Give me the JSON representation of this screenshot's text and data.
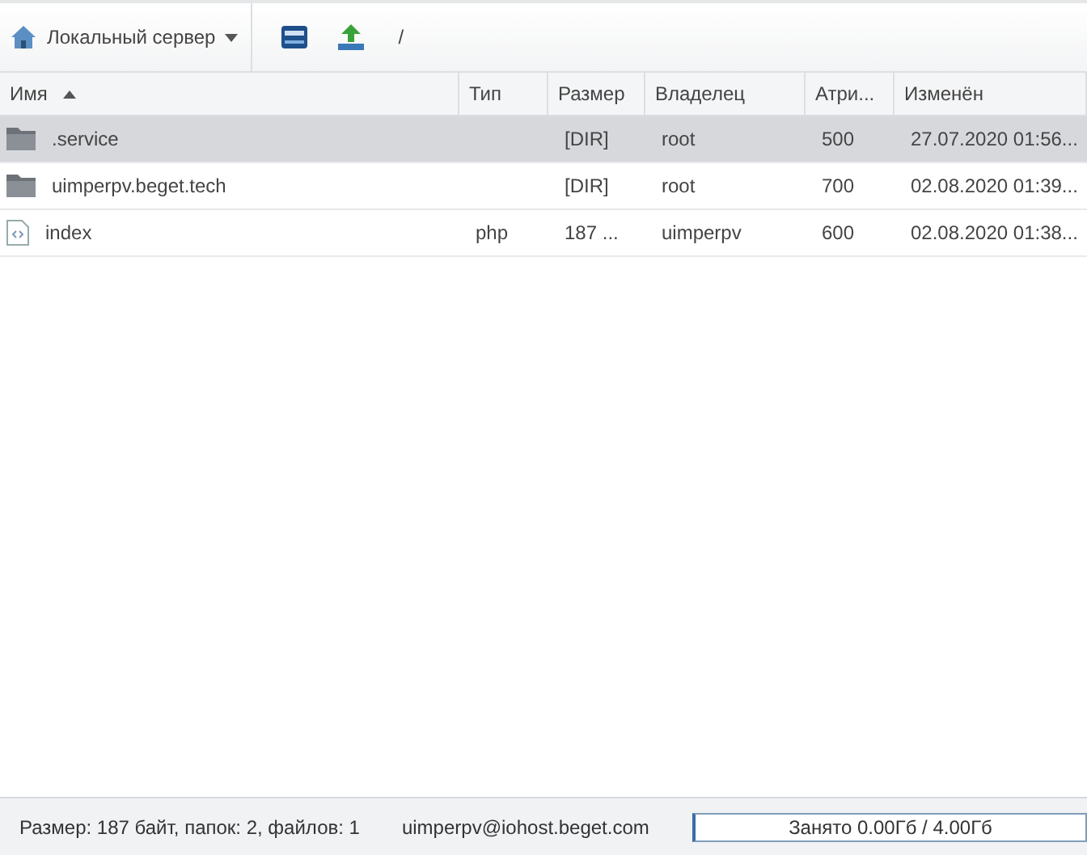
{
  "toolbar": {
    "server": "Локальный сервер",
    "path": "/"
  },
  "table": {
    "columns": [
      {
        "label": "Имя",
        "sorted": true
      },
      {
        "label": "Тип",
        "sorted": false
      },
      {
        "label": "Размер",
        "sorted": false
      },
      {
        "label": "Владелец",
        "sorted": false
      },
      {
        "label": "Атри...",
        "sorted": false
      },
      {
        "label": "Изменён",
        "sorted": false
      }
    ],
    "rows": [
      {
        "kind": "folder",
        "selected": true,
        "name": ".service",
        "type": "",
        "size": "[DIR]",
        "owner": "root",
        "attrs": "500",
        "modified": "27.07.2020 01:56..."
      },
      {
        "kind": "folder",
        "selected": false,
        "name": "uimperpv.beget.tech",
        "type": "",
        "size": "[DIR]",
        "owner": "root",
        "attrs": "700",
        "modified": "02.08.2020 01:39..."
      },
      {
        "kind": "file",
        "selected": false,
        "name": "index",
        "type": "php",
        "size": "187 ...",
        "owner": "uimperpv",
        "attrs": "600",
        "modified": "02.08.2020 01:38..."
      }
    ]
  },
  "status_bar": {
    "summary": "Размер: 187 байт, папок: 2, файлов: 1",
    "account": "uimperpv@iohost.beget.com",
    "quota": {
      "label": "Занято 0.00Гб / 4.00Гб",
      "level": 0
    }
  }
}
